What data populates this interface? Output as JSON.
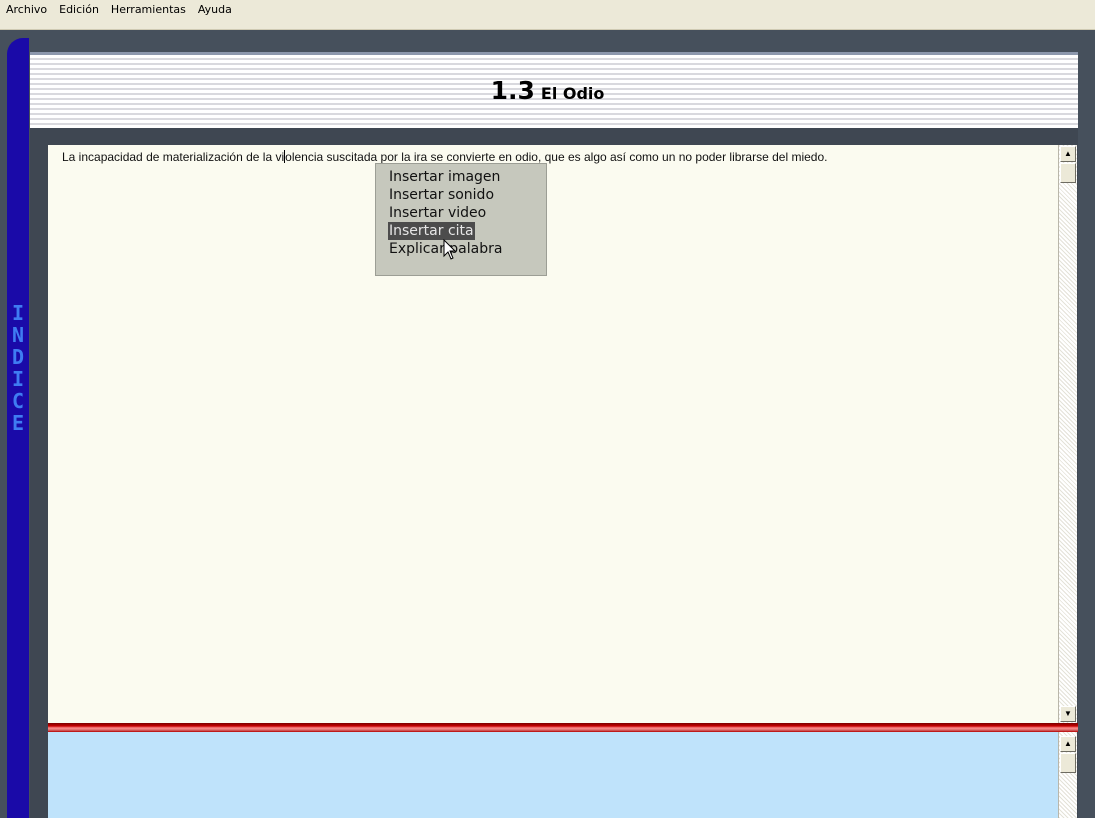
{
  "menubar": {
    "items": [
      "Archivo",
      "Edición",
      "Herramientas",
      "Ayuda"
    ]
  },
  "sidebar": {
    "letters": [
      "I",
      "N",
      "D",
      "I",
      "C",
      "E"
    ]
  },
  "page": {
    "section_number": "1.3",
    "section_title": "El Odio"
  },
  "editor": {
    "text_before_cursor": "La incapacidad de materialización de la vi",
    "text_after_cursor": "olencia suscitada por la ira se convierte en odio, que es algo así como un no poder librarse del miedo."
  },
  "context_menu": {
    "items": [
      "Insertar imagen",
      "Insertar sonido",
      "Insertar video",
      "Insertar cita",
      "Explicar palabra"
    ],
    "highlighted_index": 3
  },
  "colors": {
    "sidebar": "#1a0aa8",
    "sidebar_letters": "#3f7cf2",
    "editor_bg": "#fbfbf0",
    "notes_bg": "#bfe3fb",
    "divider": "#c40000"
  }
}
